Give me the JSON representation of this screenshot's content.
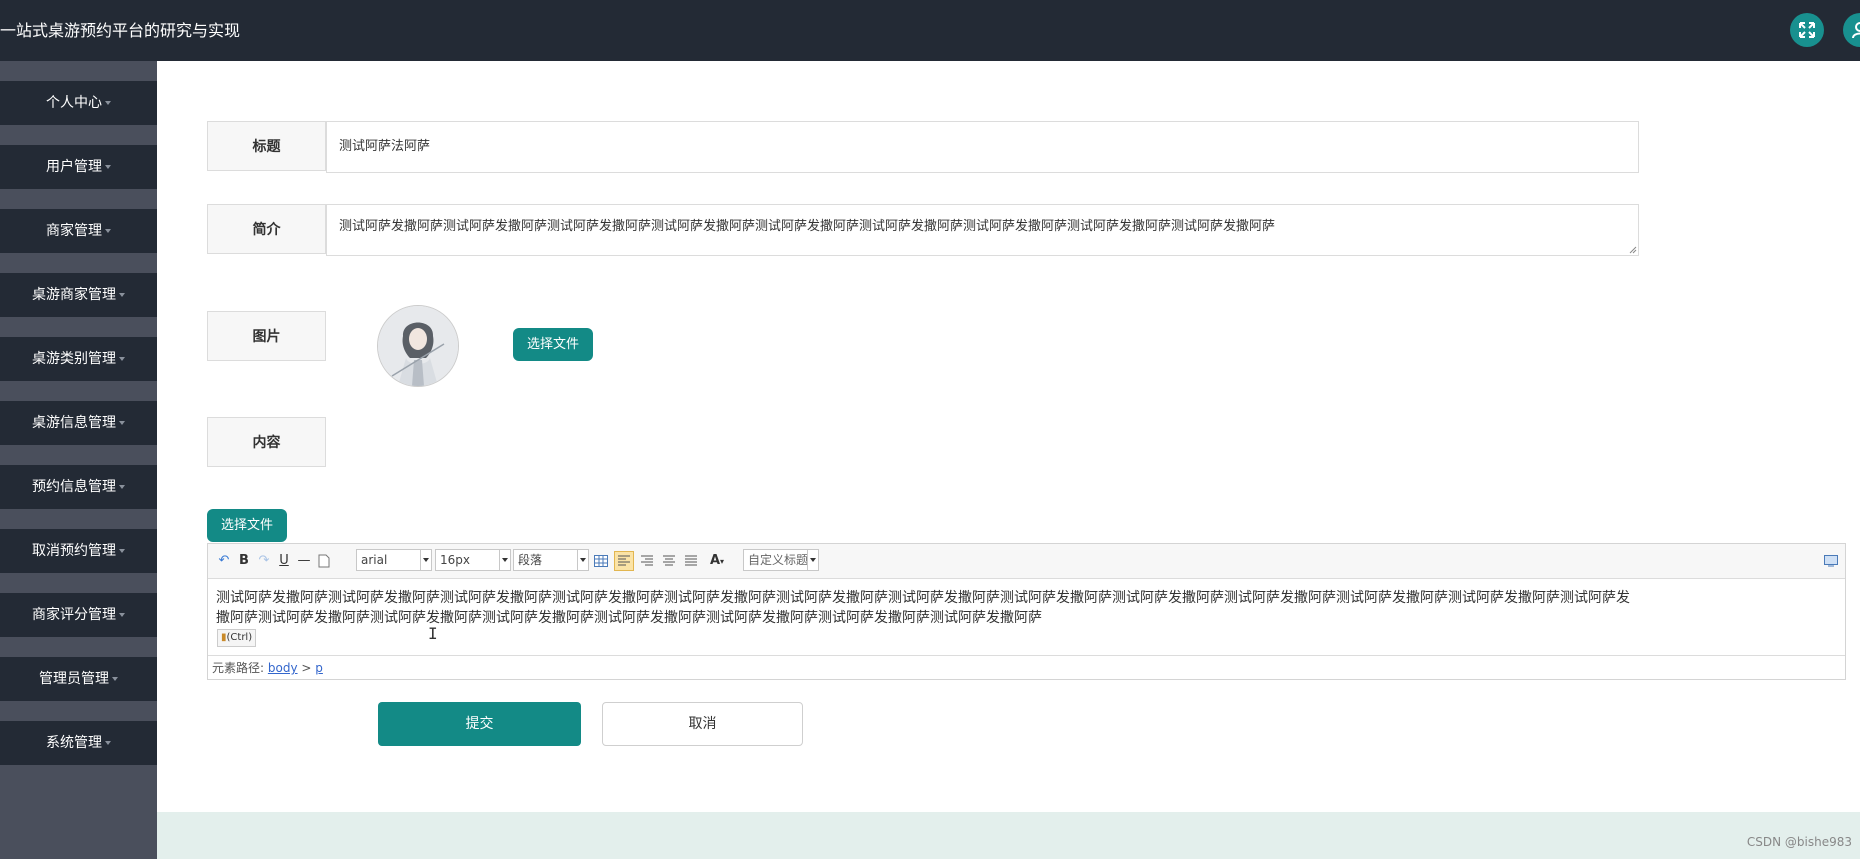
{
  "header": {
    "title": "一站式桌游预约平台的研究与实现"
  },
  "colors": {
    "topbar": "#232a35",
    "accent": "#138a86",
    "sidebar_bg": "#4a4f5c",
    "footer_band": "#e3efec"
  },
  "icons": {
    "fullscreen": "expand-arrows-icon",
    "user": "user-icon"
  },
  "sidebar": {
    "items": [
      {
        "label": "个人中心"
      },
      {
        "label": "用户管理"
      },
      {
        "label": "商家管理"
      },
      {
        "label": "桌游商家管理"
      },
      {
        "label": "桌游类别管理"
      },
      {
        "label": "桌游信息管理"
      },
      {
        "label": "预约信息管理"
      },
      {
        "label": "取消预约管理"
      },
      {
        "label": "商家评分管理"
      },
      {
        "label": "管理员管理"
      },
      {
        "label": "系统管理"
      }
    ]
  },
  "form": {
    "title_label": "标题",
    "title_value": "测试阿萨法阿萨",
    "intro_label": "简介",
    "intro_value": "测试阿萨发撒阿萨测试阿萨发撒阿萨测试阿萨发撒阿萨测试阿萨发撒阿萨测试阿萨发撒阿萨测试阿萨发撒阿萨测试阿萨发撒阿萨测试阿萨发撒阿萨测试阿萨发撒阿萨",
    "image_label": "图片",
    "image_button": "选择文件",
    "content_label": "内容",
    "content_upload_button": "选择文件"
  },
  "editor": {
    "font_family": "arial",
    "font_size": "16px",
    "paragraph": "段落",
    "custom_title": "自定义标题",
    "content_line1": "测试阿萨发撒阿萨测试阿萨发撒阿萨测试阿萨发撒阿萨测试阿萨发撒阿萨测试阿萨发撒阿萨测试阿萨发撒阿萨测试阿萨发撒阿萨测试阿萨发撒阿萨测试阿萨发撒阿萨测试阿萨发撒阿萨测试阿萨发撒阿萨测试阿萨发撒阿萨测试阿萨发",
    "content_line2": "撒阿萨测试阿萨发撒阿萨测试阿萨发撒阿萨测试阿萨发撒阿萨测试阿萨发撒阿萨测试阿萨发撒阿萨测试阿萨发撒阿萨测试阿萨发撒阿萨",
    "paste_badge": "(Ctrl)",
    "path_label": "元素路径:",
    "path_body": "body",
    "path_sep": ">",
    "path_p": "p"
  },
  "actions": {
    "submit": "提交",
    "cancel": "取消"
  },
  "footer": {
    "watermark": "CSDN @bishe983"
  }
}
